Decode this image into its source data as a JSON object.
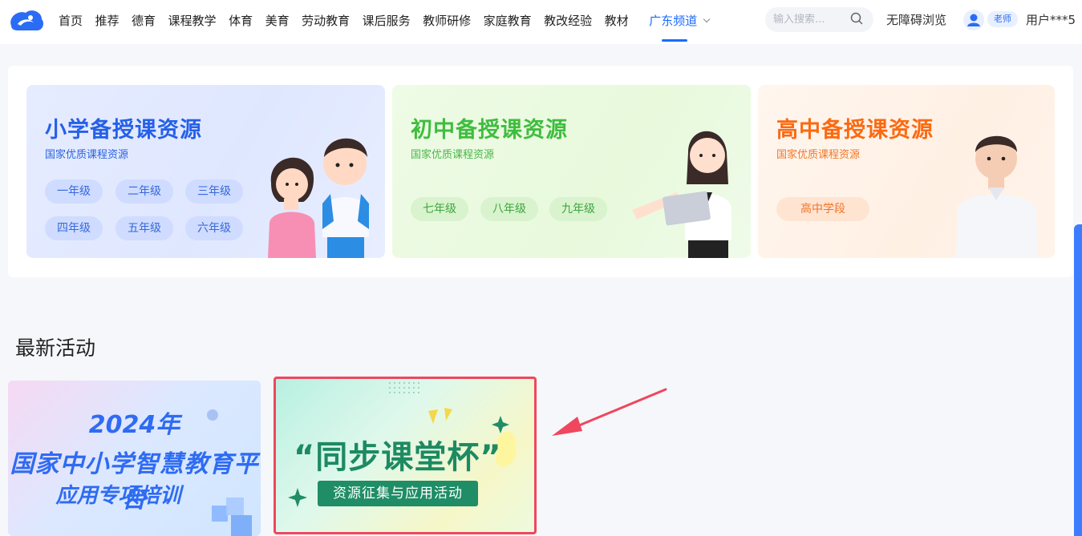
{
  "nav": {
    "items": [
      "首页",
      "推荐",
      "德育",
      "课程教学",
      "体育",
      "美育",
      "劳动教育",
      "课后服务",
      "教师研修",
      "家庭教育",
      "教改经验",
      "教材"
    ],
    "active": "广东频道"
  },
  "search": {
    "placeholder": "输入搜索..."
  },
  "header": {
    "accessibility": "无障碍浏览",
    "role": "老师",
    "user": "用户***5"
  },
  "resources": [
    {
      "title": "小学备授课资源",
      "subtitle": "国家优质课程资源",
      "grades": [
        "一年级",
        "二年级",
        "三年级",
        "四年级",
        "五年级",
        "六年级"
      ]
    },
    {
      "title": "初中备授课资源",
      "subtitle": "国家优质课程资源",
      "grades": [
        "七年级",
        "八年级",
        "九年级"
      ]
    },
    {
      "title": "高中备授课资源",
      "subtitle": "国家优质课程资源",
      "grades": [
        "高中学段"
      ]
    }
  ],
  "activities": {
    "title": "最新活动",
    "items": [
      {
        "lines": [
          "2024年",
          "国家中小学智慧教育平台",
          "应用专项培训"
        ]
      },
      {
        "title": "“同步课堂杯”",
        "subtitle": "资源征集与应用活动"
      }
    ]
  },
  "colors": {
    "brand": "#1a6cff",
    "primary_green": "#3fbd3f",
    "senior_orange": "#fb6a12",
    "highlight_red": "#f0465e"
  }
}
